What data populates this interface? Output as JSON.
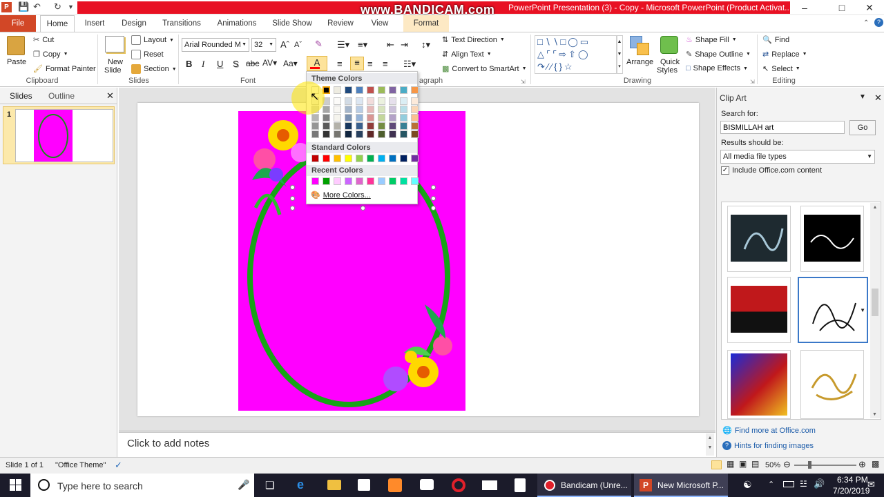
{
  "window": {
    "title": "PowerPoint Presentation (3) - Copy  -  Microsoft PowerPoint (Product Activat...",
    "watermark": "www.BANDICAM.com"
  },
  "tabs": [
    {
      "label": "File"
    },
    {
      "label": "Home"
    },
    {
      "label": "Insert"
    },
    {
      "label": "Design"
    },
    {
      "label": "Transitions"
    },
    {
      "label": "Animations"
    },
    {
      "label": "Slide Show"
    },
    {
      "label": "Review"
    },
    {
      "label": "View"
    },
    {
      "label": "Format"
    }
  ],
  "ribbon": {
    "clipboard": {
      "paste": "Paste",
      "cut": "Cut",
      "copy": "Copy",
      "format_painter": "Format Painter",
      "label": "Clipboard"
    },
    "slides": {
      "new_slide_1": "New",
      "new_slide_2": "Slide",
      "layout": "Layout",
      "reset": "Reset",
      "section": "Section",
      "label": "Slides"
    },
    "font": {
      "name": "Arial Rounded M",
      "size": "32",
      "label": "Font"
    },
    "paragraph": {
      "text_direction": "Text Direction",
      "align_text": "Align Text",
      "convert": "Convert to SmartArt",
      "label": "agraph"
    },
    "drawing": {
      "arrange": "Arrange",
      "quick_styles_1": "Quick",
      "quick_styles_2": "Styles",
      "shape_fill": "Shape Fill",
      "shape_outline": "Shape Outline",
      "shape_effects": "Shape Effects",
      "label": "Drawing"
    },
    "editing": {
      "find": "Find",
      "replace": "Replace",
      "select": "Select",
      "label": "Editing"
    }
  },
  "color_popup": {
    "theme_label": "Theme Colors",
    "standard_label": "Standard Colors",
    "recent_label": "Recent Colors",
    "more_colors": "More Colors...",
    "theme_colors": [
      "#ffffff",
      "#000000",
      "#eeece1",
      "#1f497d",
      "#4f81bd",
      "#c0504d",
      "#9bbb59",
      "#8064a2",
      "#4bacc6",
      "#f79646"
    ],
    "standard_colors": [
      "#c00000",
      "#ff0000",
      "#ffc000",
      "#ffff00",
      "#92d050",
      "#00b050",
      "#00b0f0",
      "#0070c0",
      "#002060",
      "#7030a0"
    ],
    "recent_colors": [
      "#ff00ff",
      "#00a000",
      "#ffccff",
      "#cc66ff",
      "#e066cc",
      "#ff3399",
      "#99ccff",
      "#00cc66",
      "#00e0a0",
      "#66ffff"
    ]
  },
  "left_pane": {
    "slides_tab": "Slides",
    "outline_tab": "Outline",
    "slide_number": "1"
  },
  "notes": {
    "placeholder": "Click to add notes"
  },
  "clip_art": {
    "title": "Clip Art",
    "search_label": "Search for:",
    "search_value": "BISMILLAH art",
    "go": "Go",
    "results_label": "Results should be:",
    "results_value": "All media file types",
    "include_office": "Include Office.com content",
    "find_more": "Find more at Office.com",
    "hints": "Hints for finding images"
  },
  "status": {
    "slide": "Slide 1 of 1",
    "theme": "\"Office Theme\"",
    "zoom": "50%"
  },
  "taskbar": {
    "search_placeholder": "Type here to search",
    "bandicam_app": "Bandicam (Unre...",
    "ppt_app": "New Microsoft P...",
    "time": "6:34 PM",
    "date": "7/20/2019"
  }
}
